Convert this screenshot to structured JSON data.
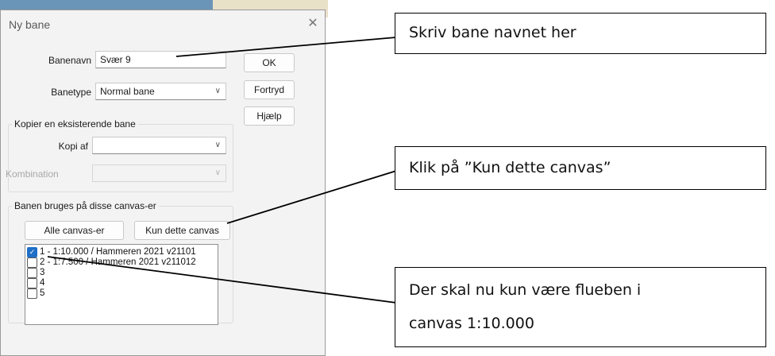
{
  "dialog": {
    "title": "Ny bane",
    "banenavn_label": "Banenavn",
    "banenavn_value": "Svær 9",
    "banetype_label": "Banetype",
    "banetype_value": "Normal bane",
    "copy_group_label": "Kopier en eksisterende bane",
    "kopi_af_label": "Kopi af",
    "kopi_af_value": "",
    "kombination_label": "Kombination",
    "kombination_value": "",
    "ok_label": "OK",
    "cancel_label": "Fortryd",
    "help_label": "Hjælp",
    "canvas_group_label": "Banen bruges på disse canvas-er",
    "all_canvas_label": "Alle canvas-er",
    "only_canvas_label": "Kun dette canvas",
    "canvas_list": [
      {
        "label": "1 - 1:10.000 / Hammeren 2021 v21101",
        "checked": true
      },
      {
        "label": "2 - 1:7.500 / Hammeren 2021 v211012",
        "checked": false
      },
      {
        "label": "3",
        "checked": false
      },
      {
        "label": "4",
        "checked": false
      },
      {
        "label": "5",
        "checked": false
      }
    ]
  },
  "callouts": {
    "name_note": "Skriv bane navnet her",
    "canvas_note": "Klik på ”Kun dette canvas”",
    "check_note_line1": "Der skal nu kun være flueben i",
    "check_note_line2": "canvas 1:10.000"
  }
}
